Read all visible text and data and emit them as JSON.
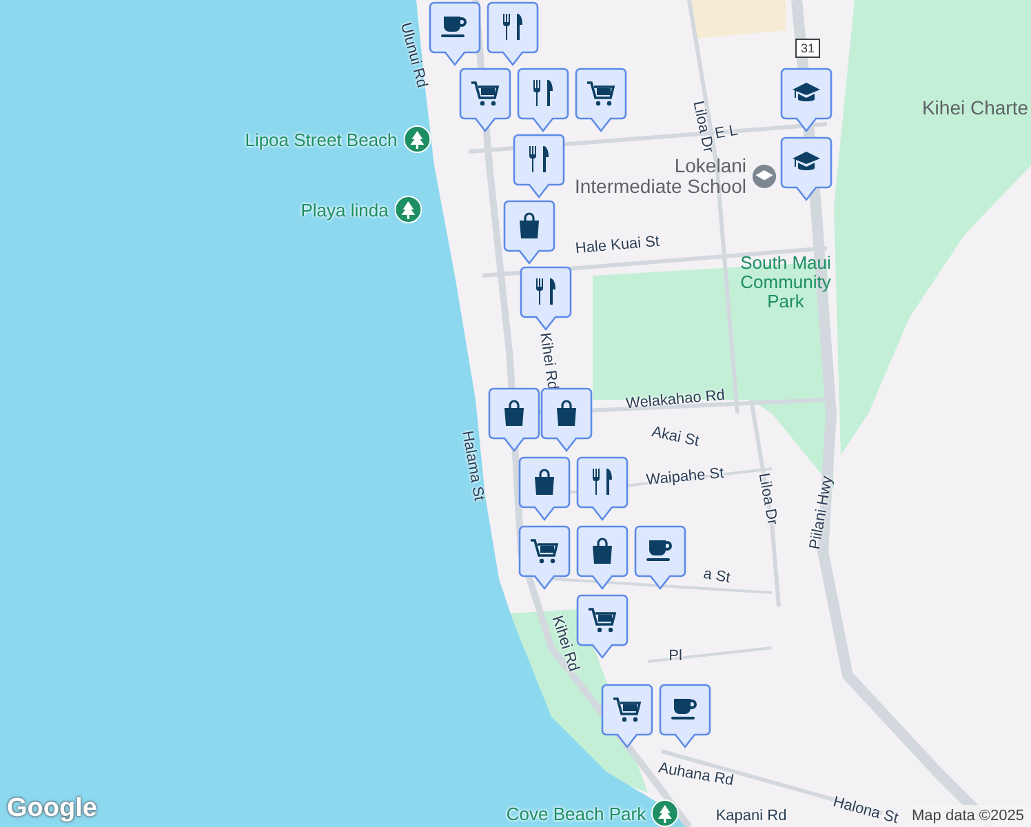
{
  "map": {
    "labels": [
      {
        "text": "Ulunui Rd",
        "kind": "street"
      },
      {
        "text": "Lipoa Street Beach",
        "kind": "beach"
      },
      {
        "text": "Playa linda",
        "kind": "beach"
      },
      {
        "text": "Liloa Dr",
        "kind": "street"
      },
      {
        "text": "E L",
        "kind": "street"
      },
      {
        "text": "Kihei Charte",
        "kind": "place"
      },
      {
        "text": "Lokelani Intermediate School",
        "kind": "school"
      },
      {
        "text": "Hale Kuai St",
        "kind": "street"
      },
      {
        "text": "South Maui Community Park",
        "kind": "park"
      },
      {
        "text": "Kihei Rd",
        "kind": "street"
      },
      {
        "text": "Welakahao Rd",
        "kind": "street"
      },
      {
        "text": "Halama St",
        "kind": "street"
      },
      {
        "text": "Akai St",
        "kind": "street"
      },
      {
        "text": "Waipahe St",
        "kind": "street"
      },
      {
        "text": "Liloa Dr",
        "kind": "street"
      },
      {
        "text": "Piilani Hwy",
        "kind": "street"
      },
      {
        "text": "a St",
        "kind": "street"
      },
      {
        "text": "Kihei Rd",
        "kind": "street"
      },
      {
        "text": "Pl",
        "kind": "street"
      },
      {
        "text": "Auhana Rd",
        "kind": "street"
      },
      {
        "text": "Halona St",
        "kind": "street"
      },
      {
        "text": "Cove Beach Park",
        "kind": "beach"
      },
      {
        "text": "Kapani Rd",
        "kind": "street"
      }
    ],
    "markers": [
      {
        "kind": "cafe"
      },
      {
        "kind": "restaurant"
      },
      {
        "kind": "grocery"
      },
      {
        "kind": "restaurant"
      },
      {
        "kind": "grocery"
      },
      {
        "kind": "school"
      },
      {
        "kind": "school"
      },
      {
        "kind": "restaurant"
      },
      {
        "kind": "shop"
      },
      {
        "kind": "restaurant"
      },
      {
        "kind": "shop"
      },
      {
        "kind": "shop"
      },
      {
        "kind": "shop"
      },
      {
        "kind": "restaurant"
      },
      {
        "kind": "grocery"
      },
      {
        "kind": "shop"
      },
      {
        "kind": "cafe"
      },
      {
        "kind": "grocery"
      },
      {
        "kind": "grocery"
      },
      {
        "kind": "cafe"
      }
    ],
    "route_shield": "31",
    "logo": "Google",
    "attribution": "Map data ©2025"
  }
}
